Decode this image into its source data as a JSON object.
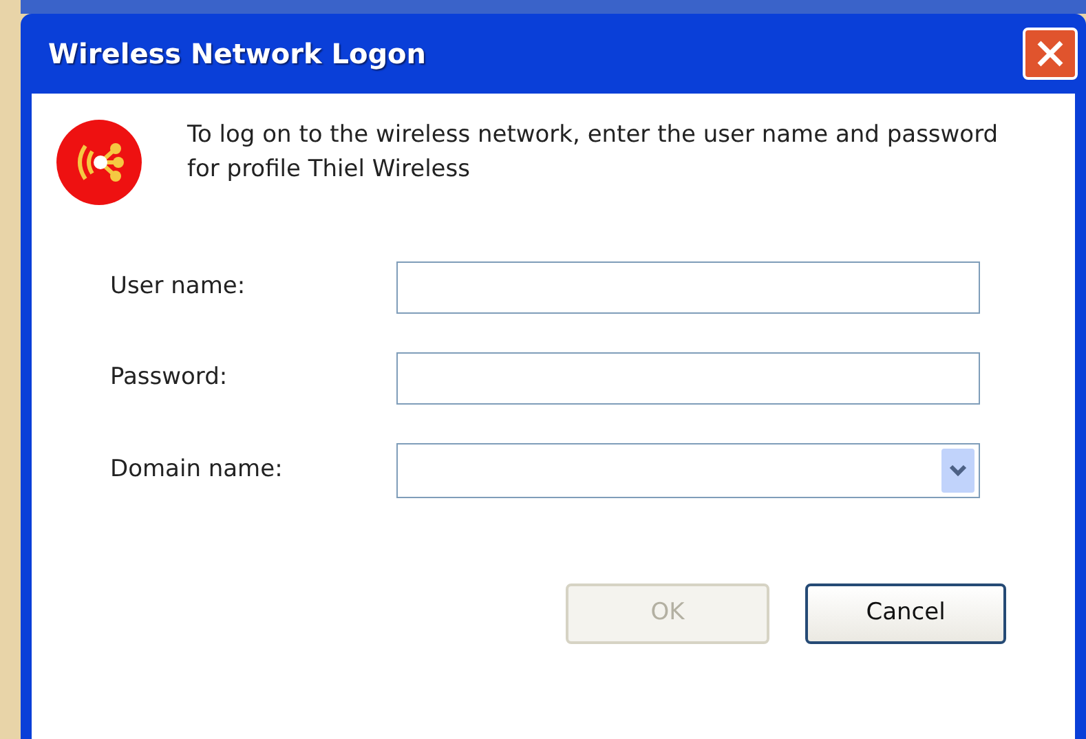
{
  "window": {
    "title": "Wireless Network Logon"
  },
  "message": "To log on to the wireless network, enter the user name and password for profile Thiel Wireless",
  "fields": [
    {
      "label": "User name:",
      "kind": "text"
    },
    {
      "label": "Password:",
      "kind": "password"
    },
    {
      "label": "Domain name:",
      "kind": "dropdown"
    }
  ],
  "buttons": [
    {
      "label": "OK",
      "disabled": true
    },
    {
      "label": "Cancel",
      "disabled": false
    }
  ]
}
